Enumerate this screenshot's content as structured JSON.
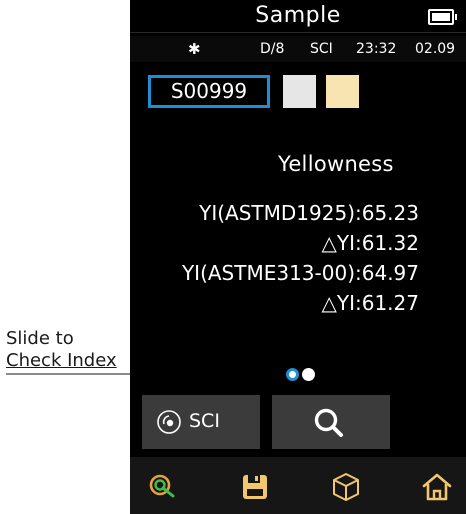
{
  "header": {
    "title": "Sample"
  },
  "status": {
    "bluetooth_icon": "bluetooth-icon",
    "geometry": "D/8",
    "mode": "SCI",
    "time": "23:32",
    "date": "02.09"
  },
  "sample": {
    "id": "S00999",
    "swatch_colors": [
      "#e6e6e6",
      "#f7e4b0"
    ]
  },
  "measurement": {
    "heading": "Yellowness",
    "lines": [
      "YI(ASTMD1925):65.23",
      "△YI:61.32",
      "YI(ASTME313-00):64.97",
      "△YI:61.27"
    ]
  },
  "pager": {
    "pages": 2,
    "active": 1
  },
  "buttons": {
    "sci_label": "SCI",
    "sci_icon": "sci-mode-icon",
    "search_icon": "search-icon"
  },
  "nav": {
    "items": [
      "target-icon",
      "save-icon",
      "cube-icon",
      "home-icon"
    ]
  },
  "annotation": {
    "line1": "Slide to",
    "line2": "Check Index"
  },
  "colors": {
    "accent": "#1e8fd6",
    "background": "#000000",
    "button": "#3b3b3b",
    "target_green": "#3fbf4a",
    "target_orange": "#e8a23a",
    "save_gold": "#f2c66b"
  }
}
